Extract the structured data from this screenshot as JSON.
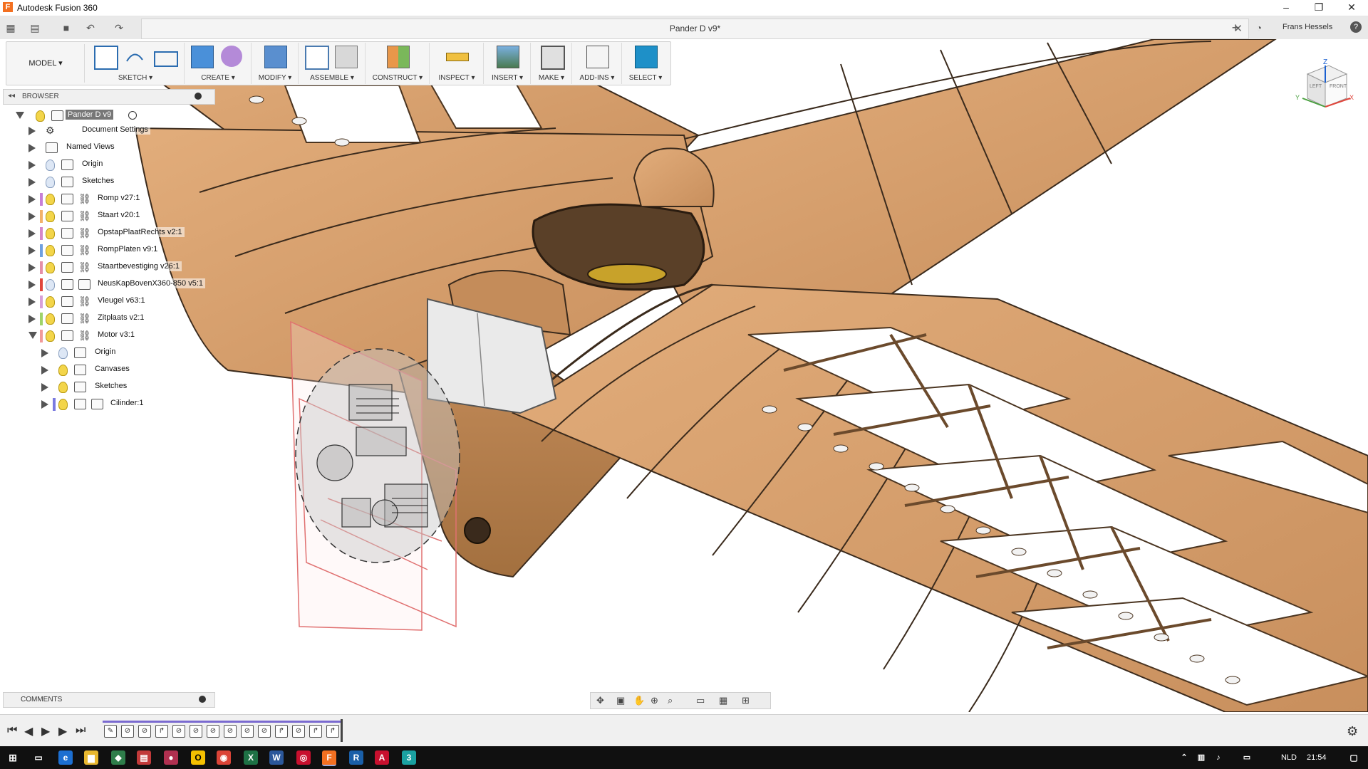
{
  "window": {
    "app_title": "Autodesk Fusion 360",
    "app_icon_letter": "F",
    "minimize": "–",
    "restore": "❐",
    "close": "✕"
  },
  "tabbar": {
    "doc_title": "Pander D v9*",
    "close": "✕",
    "add": "+",
    "user": "Frans Hessels",
    "help": "?"
  },
  "toolbar": {
    "workspace": "MODEL ▾",
    "groups": [
      {
        "label": "SKETCH ▾",
        "icons": [
          "create-sketch-icon",
          "line-icon",
          "rectangle-icon"
        ]
      },
      {
        "label": "CREATE ▾",
        "icons": [
          "extrude-icon",
          "form-icon"
        ]
      },
      {
        "label": "MODIFY ▾",
        "icons": [
          "press-pull-icon"
        ]
      },
      {
        "label": "ASSEMBLE ▾",
        "icons": [
          "new-component-icon",
          "joint-icon"
        ]
      },
      {
        "label": "CONSTRUCT ▾",
        "icons": [
          "offset-plane-icon"
        ]
      },
      {
        "label": "INSPECT ▾",
        "icons": [
          "measure-icon"
        ]
      },
      {
        "label": "INSERT ▾",
        "icons": [
          "insert-image-icon"
        ]
      },
      {
        "label": "MAKE ▾",
        "icons": [
          "3d-print-icon"
        ]
      },
      {
        "label": "ADD-INS ▾",
        "icons": [
          "scripts-icon"
        ]
      },
      {
        "label": "SELECT ▾",
        "icons": [
          "select-icon"
        ]
      }
    ]
  },
  "browser": {
    "title": "BROWSER",
    "root": "Pander D v9",
    "items": [
      {
        "label": "Document Settings",
        "type": "settings",
        "color": ""
      },
      {
        "label": "Named Views",
        "type": "folder",
        "color": ""
      },
      {
        "label": "Origin",
        "type": "folder",
        "color": "",
        "bulb": "off"
      },
      {
        "label": "Sketches",
        "type": "folder",
        "color": "",
        "bulb": "off"
      },
      {
        "label": "Romp v27:1",
        "type": "link",
        "color": "#c77fd6",
        "bulb": "on"
      },
      {
        "label": "Staart v20:1",
        "type": "link",
        "color": "#f2b26b",
        "bulb": "on"
      },
      {
        "label": "OpstapPlaatRechts v2:1",
        "type": "link",
        "color": "#d687c9",
        "bulb": "on"
      },
      {
        "label": "RompPlaten v9:1",
        "type": "link",
        "color": "#6fa0e0",
        "bulb": "on"
      },
      {
        "label": "Staartbevestiging v26:1",
        "type": "link",
        "color": "#e58fa8",
        "bulb": "on"
      },
      {
        "label": "NeusKapBovenX360-850 v5:1",
        "type": "component",
        "color": "#e0463c",
        "bulb": "off"
      },
      {
        "label": "Vleugel v63:1",
        "type": "link",
        "color": "#d8a0d8",
        "bulb": "on"
      },
      {
        "label": "Zitplaats v2:1",
        "type": "link",
        "color": "#9fd36a",
        "bulb": "on"
      },
      {
        "label": "Motor v3:1",
        "type": "link",
        "color": "#f19a9a",
        "bulb": "on",
        "open": true
      },
      {
        "label": "Origin",
        "type": "folder",
        "color": "",
        "bulb": "off",
        "child": true
      },
      {
        "label": "Canvases",
        "type": "folder",
        "color": "",
        "bulb": "on",
        "child": true
      },
      {
        "label": "Sketches",
        "type": "folder",
        "color": "",
        "bulb": "on",
        "child": true
      },
      {
        "label": "Cilinder:1",
        "type": "component",
        "color": "#7a7ae0",
        "bulb": "on",
        "child": true
      }
    ]
  },
  "viewcube": {
    "top": "Z",
    "left": "LEFT",
    "front": "FRONT",
    "x": "X",
    "y": "Y"
  },
  "comments": {
    "label": "COMMENTS"
  },
  "taskbar": {
    "lang": "NLD",
    "time": "21:54"
  },
  "colors": {
    "wood": "#d9a06c",
    "wood_dark": "#b98253",
    "accent": "#1e90c8"
  }
}
